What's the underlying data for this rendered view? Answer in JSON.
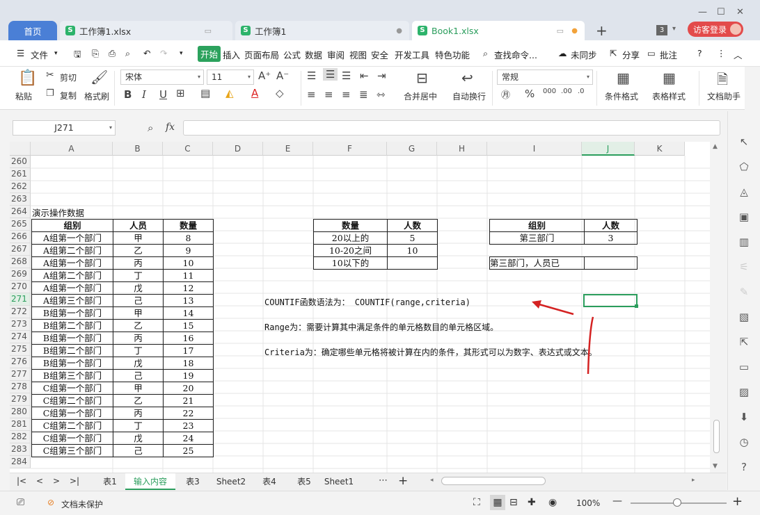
{
  "tabs": {
    "home": "首页",
    "file1": "工作簿1.xlsx",
    "file2": "工作簿1",
    "file3": "Book1.xlsx",
    "count": "3",
    "guest": "访客登录"
  },
  "menu": [
    "文件",
    "开始",
    "插入",
    "页面布局",
    "公式",
    "数据",
    "审阅",
    "视图",
    "安全",
    "开发工具",
    "特色功能",
    "查找命令...",
    "未同步",
    "分享",
    "批注"
  ],
  "ribbon": {
    "paste": "粘贴",
    "cut": "剪切",
    "copy": "复制",
    "format_painter": "格式刷",
    "font": "宋体",
    "size": "11",
    "merge": "合并居中",
    "wrap": "自动换行",
    "number_format": "常规",
    "cond_format": "条件格式",
    "table_style": "表格样式",
    "doc_helper": "文档助手"
  },
  "formula": {
    "namebox": "J271",
    "fx": "fx",
    "value": ""
  },
  "columns": [
    "A",
    "B",
    "C",
    "D",
    "E",
    "F",
    "G",
    "H",
    "I",
    "J",
    "K"
  ],
  "rows": [
    "260",
    "261",
    "262",
    "263",
    "264",
    "265",
    "266",
    "267",
    "268",
    "269",
    "270",
    "271",
    "272",
    "273",
    "274",
    "275",
    "276",
    "277",
    "278",
    "279",
    "280",
    "281",
    "282",
    "283",
    "284"
  ],
  "sheet": {
    "demo_title": "演示操作数据",
    "main_table": {
      "headers": [
        "组别",
        "人员",
        "数量"
      ],
      "rows": [
        [
          "A组第一个部门",
          "甲",
          "8"
        ],
        [
          "A组第二个部门",
          "乙",
          "9"
        ],
        [
          "A组第一个部门",
          "丙",
          "10"
        ],
        [
          "A组第二个部门",
          "丁",
          "11"
        ],
        [
          "A组第一个部门",
          "戊",
          "12"
        ],
        [
          "A组第三个部门",
          "己",
          "13"
        ],
        [
          "B组第一个部门",
          "甲",
          "14"
        ],
        [
          "B组第二个部门",
          "乙",
          "15"
        ],
        [
          "B组第一个部门",
          "丙",
          "16"
        ],
        [
          "B组第二个部门",
          "丁",
          "17"
        ],
        [
          "B组第一个部门",
          "戊",
          "18"
        ],
        [
          "B组第三个部门",
          "己",
          "19"
        ],
        [
          "C组第一个部门",
          "甲",
          "20"
        ],
        [
          "C组第二个部门",
          "乙",
          "21"
        ],
        [
          "C组第一个部门",
          "丙",
          "22"
        ],
        [
          "C组第二个部门",
          "丁",
          "23"
        ],
        [
          "C组第一个部门",
          "戊",
          "24"
        ],
        [
          "C组第三个部门",
          "己",
          "25"
        ]
      ]
    },
    "count_table": {
      "headers": [
        "数量",
        "人数"
      ],
      "rows": [
        [
          "20以上的",
          "5"
        ],
        [
          "10-20之间",
          "10"
        ],
        [
          "10以下的",
          ""
        ]
      ]
    },
    "group_table": {
      "headers": [
        "组别",
        "人数"
      ],
      "rows": [
        [
          "第三部门",
          "3"
        ]
      ],
      "extra": "第三部门，人员已"
    },
    "notes": [
      "COUNTIF函数语法为： COUNTIF(range,criteria)",
      "Range为：需要计算其中满足条件的单元格数目的单元格区域。",
      "Criteria为：确定哪些单元格将被计算在内的条件，其形式可以为数字、表达式或文本。"
    ]
  },
  "sheet_tabs": [
    "表1",
    "输入内容",
    "表3",
    "Sheet2",
    "表4",
    "表5",
    "Sheet1"
  ],
  "active_sheet_index": 1,
  "status": {
    "protect": "文档未保护",
    "zoom": "100%"
  },
  "colors": {
    "accent": "#2a9d5c",
    "home_tab": "#4a7fd6",
    "guest": "#e34b4b",
    "arrow": "#d42222"
  }
}
